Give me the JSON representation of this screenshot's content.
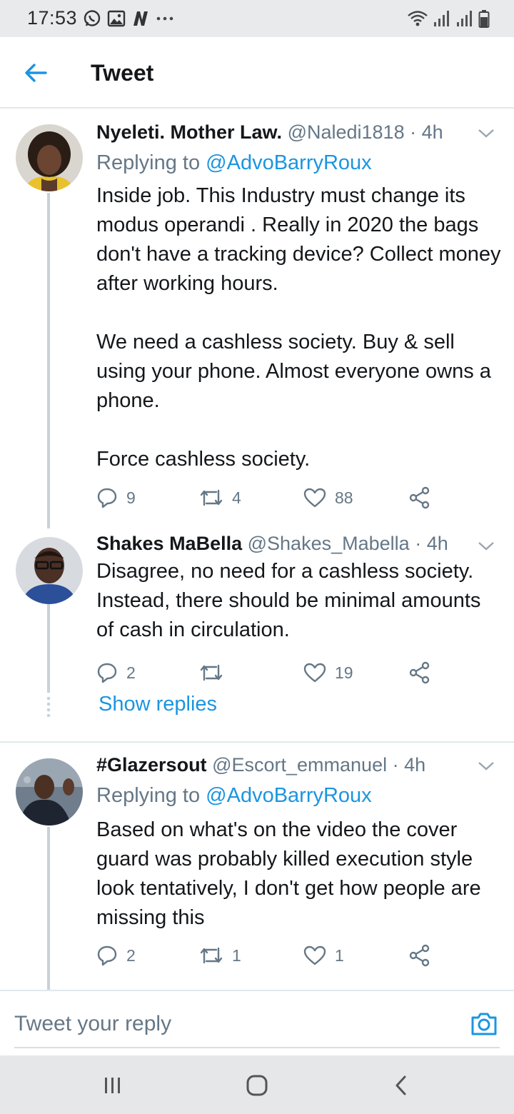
{
  "status_bar": {
    "time": "17:53",
    "left_icons": [
      "whatsapp-icon",
      "gallery-icon",
      "n-app-icon",
      "more-dots-icon"
    ],
    "right_icons": [
      "wifi-icon",
      "signal-icon",
      "signal-icon",
      "battery-icon"
    ]
  },
  "header": {
    "title": "Tweet",
    "back_icon": "arrow-left-icon",
    "accent": "#1b95e0"
  },
  "tweets": [
    {
      "name": "Nyeleti. Mother Law.",
      "handle": "@Naledi1818",
      "separator": "·",
      "time": "4h",
      "replying_prefix": "Replying to",
      "replying_to": "@AdvoBarryRoux",
      "paragraphs": [
        "Inside job. This Industry must change its modus operandi . Really in 2020 the bags don't have a tracking device? Collect money after working hours.",
        "We need a cashless society. Buy & sell using your phone. Almost everyone owns a phone.",
        "Force cashless society."
      ],
      "replies": "9",
      "retweets": "4",
      "likes": "88"
    },
    {
      "name": "Shakes MaBella",
      "handle": "@Shakes_Mabella",
      "separator": "·",
      "time": "4h",
      "paragraphs": [
        "Disagree, no need for a cashless society. Instead, there should be minimal amounts of cash in circulation."
      ],
      "replies": "2",
      "retweets": "",
      "likes": "19",
      "show_replies": "Show replies"
    },
    {
      "name": "#Glazersout",
      "handle": "@Escort_emmanuel",
      "separator": "·",
      "time": "4h",
      "replying_prefix": "Replying to",
      "replying_to": "@AdvoBarryRoux",
      "paragraphs": [
        "Based on what's on the video the cover guard was probably killed execution style look tentatively, I don't get how people are missing this"
      ],
      "replies": "2",
      "retweets": "1",
      "likes": "1"
    }
  ],
  "reply_bar": {
    "placeholder": "Tweet your reply",
    "camera_icon": "camera-icon"
  },
  "nav_bar": {
    "icons": [
      "recent-apps-icon",
      "home-icon",
      "back-icon"
    ]
  }
}
